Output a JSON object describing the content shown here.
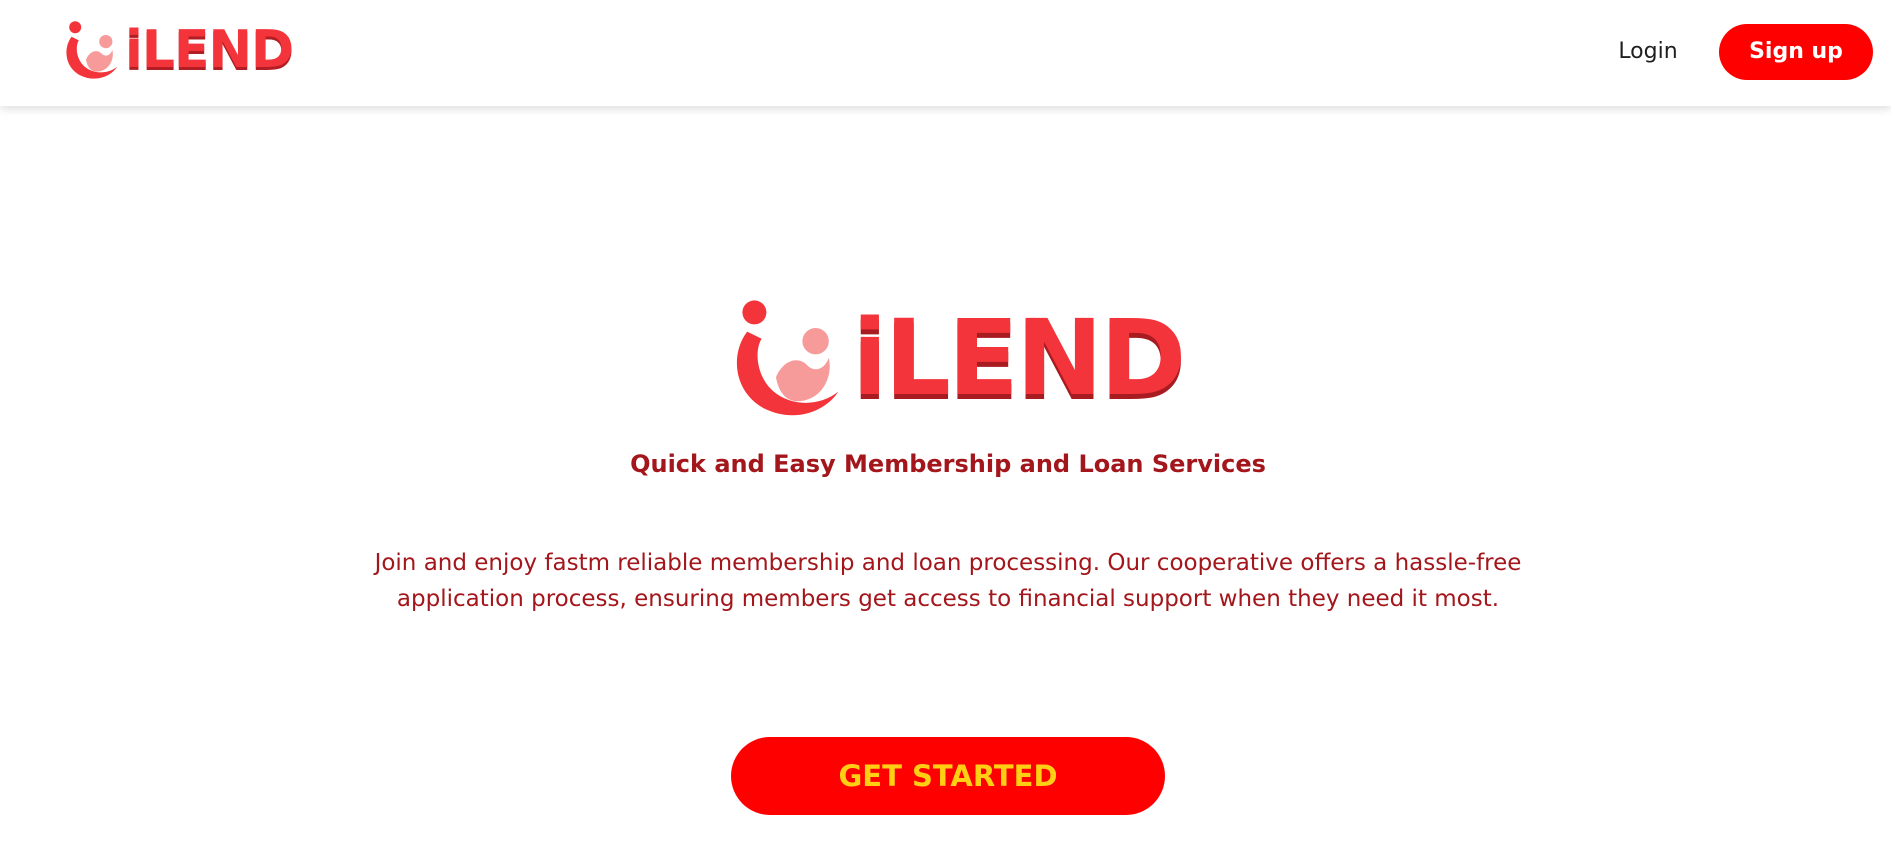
{
  "brand": {
    "name": "iLEND",
    "colors": {
      "primary_red": "#ff0000",
      "logo_red": "#f3343a",
      "logo_pink": "#f79a9a",
      "text_dark_red": "#a3161b",
      "cta_text_yellow": "#ffcf14"
    }
  },
  "nav": {
    "login_label": "Login",
    "signup_label": "Sign up"
  },
  "hero": {
    "tagline": "Quick and Easy Membership and Loan Services",
    "description": "Join and enjoy fastm reliable membership and loan processing. Our cooperative offers a hassle-free application process, ensuring members get access to financial support when they need it most.",
    "cta_label": "GET STARTED"
  },
  "icons": {
    "logo_mark": "people-circle-logo-icon"
  }
}
